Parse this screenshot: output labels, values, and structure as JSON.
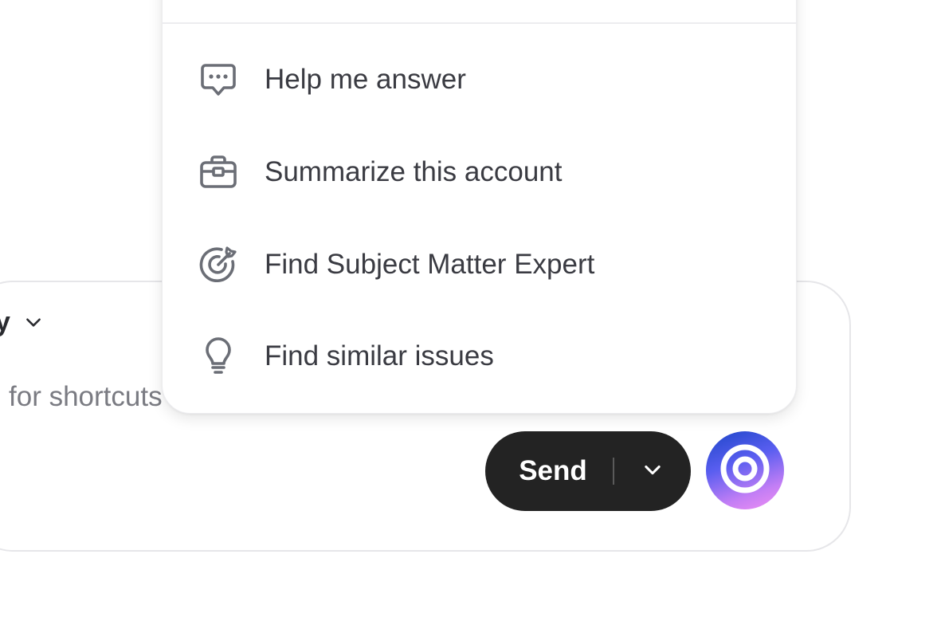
{
  "composer": {
    "mode_label": "y",
    "placeholder": "for shortcuts"
  },
  "send": {
    "label": "Send"
  },
  "menu": {
    "items": [
      {
        "label": "Help me answer",
        "icon": "chat-bubble-icon"
      },
      {
        "label": "Summarize this account",
        "icon": "briefcase-icon"
      },
      {
        "label": "Find Subject Matter Expert",
        "icon": "target-icon"
      },
      {
        "label": "Find similar issues",
        "icon": "lightbulb-icon"
      }
    ]
  },
  "colors": {
    "send_bg": "#232323",
    "menu_text": "#3a3b42",
    "icon_stroke": "#6b6e76",
    "ai_gradient_start": "#1d46c8",
    "ai_gradient_end": "#f08ff2"
  }
}
